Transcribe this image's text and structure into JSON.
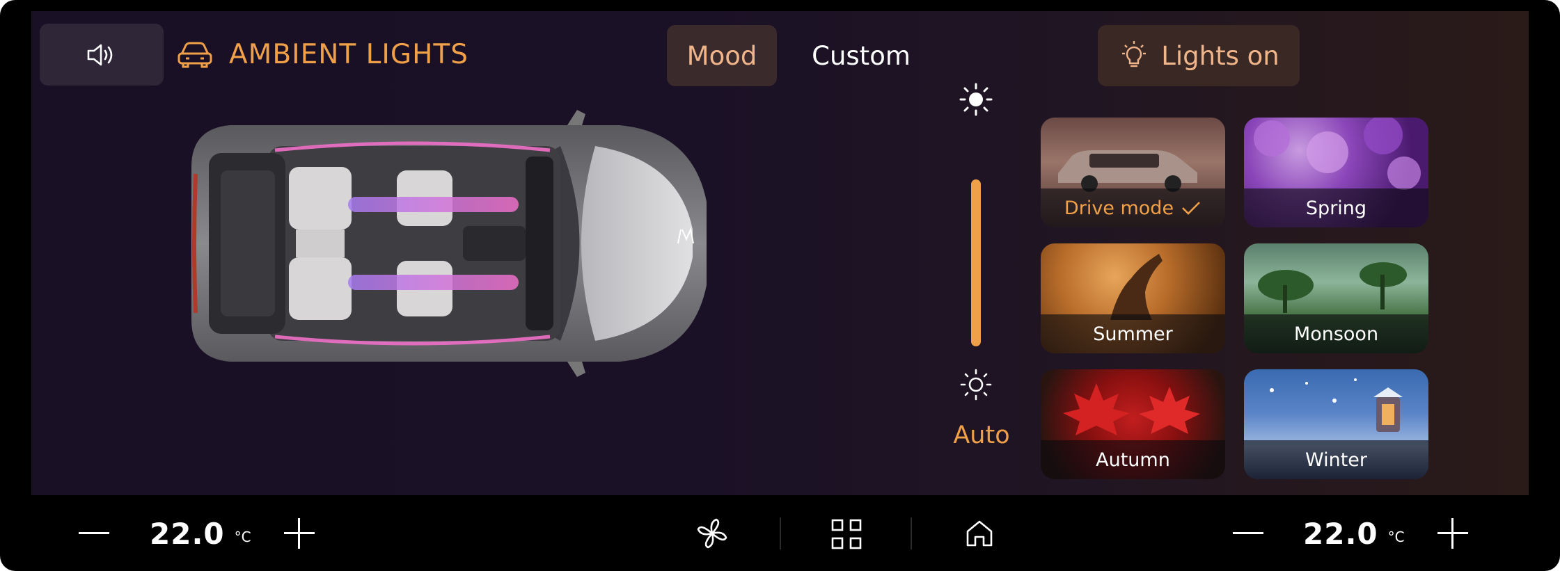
{
  "header": {
    "title": "AMBIENT LIGHTS",
    "tabs": [
      {
        "label": "Mood",
        "selected": true
      },
      {
        "label": "Custom",
        "selected": false
      }
    ],
    "lights_button": "Lights on"
  },
  "brightness": {
    "mode_label": "Auto",
    "level": 1.0
  },
  "themes": [
    {
      "label": "Drive mode",
      "selected": true
    },
    {
      "label": "Spring",
      "selected": false
    },
    {
      "label": "Summer",
      "selected": false
    },
    {
      "label": "Monsoon",
      "selected": false
    },
    {
      "label": "Autumn",
      "selected": false
    },
    {
      "label": "Winter",
      "selected": false
    }
  ],
  "climate": {
    "left_temp": "22.0",
    "right_temp": "22.0",
    "unit": "°C"
  },
  "icons": {
    "sound": "speaker-icon",
    "car": "car-icon",
    "bulb": "lightbulb-icon",
    "sun_high": "sun-bright-icon",
    "sun_low": "sun-dim-icon",
    "fan": "fan-icon",
    "apps": "grid-icon",
    "home": "home-icon"
  },
  "colors": {
    "accent": "#f0a048",
    "background": "#1a1025",
    "ambient_light": "#d76cf0"
  }
}
